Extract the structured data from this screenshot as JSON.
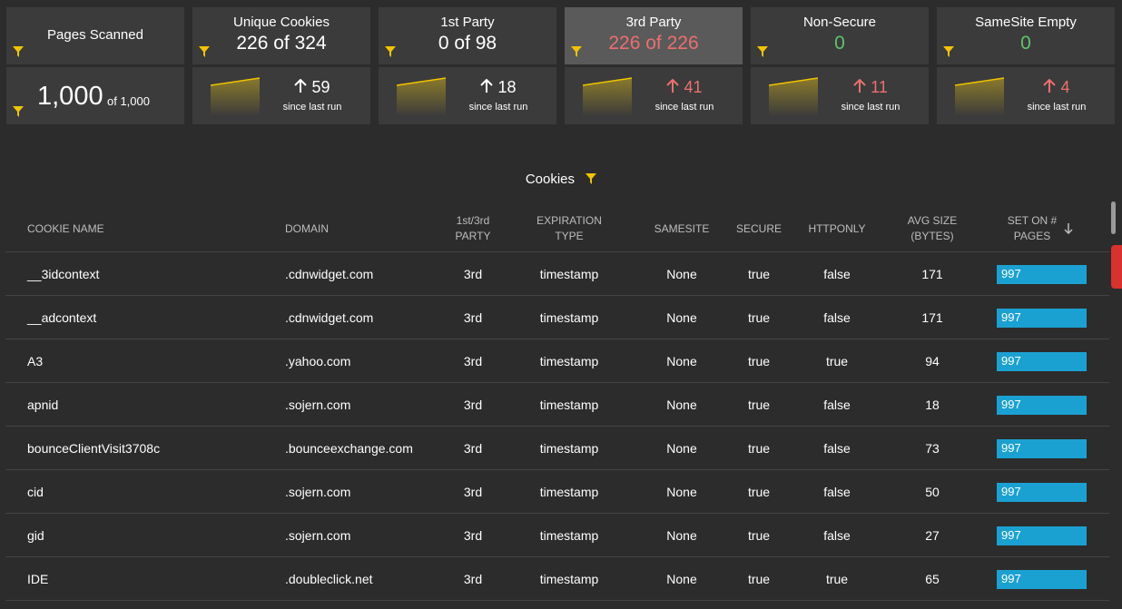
{
  "colors": {
    "background": "#2c2c2c",
    "card": "#3b3b3b",
    "card_active": "#5a5a5a",
    "accent_yellow": "#f2c400",
    "negative": "#ec6f6f",
    "positive": "#5fc46a",
    "bar_blue": "#1ba1d1",
    "alert_tab": "#d9322e"
  },
  "cards": {
    "pages": {
      "title": "Pages Scanned",
      "value": "1,000",
      "of": "of 1,000"
    },
    "unique": {
      "title": "Unique Cookies",
      "value": "226 of 324",
      "delta": "59",
      "since": "since last run"
    },
    "first": {
      "title": "1st Party",
      "value": "0 of 98",
      "delta": "18",
      "since": "since last run"
    },
    "third": {
      "title": "3rd Party",
      "value": "226 of 226",
      "delta": "41",
      "since": "since last run"
    },
    "nonsecure": {
      "title": "Non-Secure",
      "value": "0",
      "delta": "11",
      "since": "since last run"
    },
    "samesite": {
      "title": "SameSite Empty",
      "value": "0",
      "delta": "4",
      "since": "since last run"
    }
  },
  "icons": {
    "filter": "funnel-icon",
    "trend": "sparkline-icon",
    "up": "up-arrow-icon",
    "sort": "sort-down-icon"
  },
  "table": {
    "title": "Cookies",
    "headers": {
      "name": "COOKIE NAME",
      "domain": "DOMAIN",
      "party_1": "1st/3rd",
      "party_2": "PARTY",
      "exp_1": "EXPIRATION",
      "exp_2": "TYPE",
      "samesite": "SAMESITE",
      "secure": "SECURE",
      "httponly": "HTTPONLY",
      "size_1": "AVG SIZE",
      "size_2": "(BYTES)",
      "set_1": "SET ON #",
      "set_2": "PAGES"
    },
    "set_on_pages_max": 1000,
    "rows": [
      {
        "name": "__3idcontext",
        "domain": ".cdnwidget.com",
        "party": "3rd",
        "expiration": "timestamp",
        "samesite": "None",
        "secure": "true",
        "httponly": "false",
        "size": "171",
        "pages": "997"
      },
      {
        "name": "__adcontext",
        "domain": ".cdnwidget.com",
        "party": "3rd",
        "expiration": "timestamp",
        "samesite": "None",
        "secure": "true",
        "httponly": "false",
        "size": "171",
        "pages": "997"
      },
      {
        "name": "A3",
        "domain": ".yahoo.com",
        "party": "3rd",
        "expiration": "timestamp",
        "samesite": "None",
        "secure": "true",
        "httponly": "true",
        "size": "94",
        "pages": "997"
      },
      {
        "name": "apnid",
        "domain": ".sojern.com",
        "party": "3rd",
        "expiration": "timestamp",
        "samesite": "None",
        "secure": "true",
        "httponly": "false",
        "size": "18",
        "pages": "997"
      },
      {
        "name": "bounceClientVisit3708c",
        "domain": ".bounceexchange.com",
        "party": "3rd",
        "expiration": "timestamp",
        "samesite": "None",
        "secure": "true",
        "httponly": "false",
        "size": "73",
        "pages": "997"
      },
      {
        "name": "cid",
        "domain": ".sojern.com",
        "party": "3rd",
        "expiration": "timestamp",
        "samesite": "None",
        "secure": "true",
        "httponly": "false",
        "size": "50",
        "pages": "997"
      },
      {
        "name": "gid",
        "domain": ".sojern.com",
        "party": "3rd",
        "expiration": "timestamp",
        "samesite": "None",
        "secure": "true",
        "httponly": "false",
        "size": "27",
        "pages": "997"
      },
      {
        "name": "IDE",
        "domain": ".doubleclick.net",
        "party": "3rd",
        "expiration": "timestamp",
        "samesite": "None",
        "secure": "true",
        "httponly": "true",
        "size": "65",
        "pages": "997"
      }
    ]
  }
}
